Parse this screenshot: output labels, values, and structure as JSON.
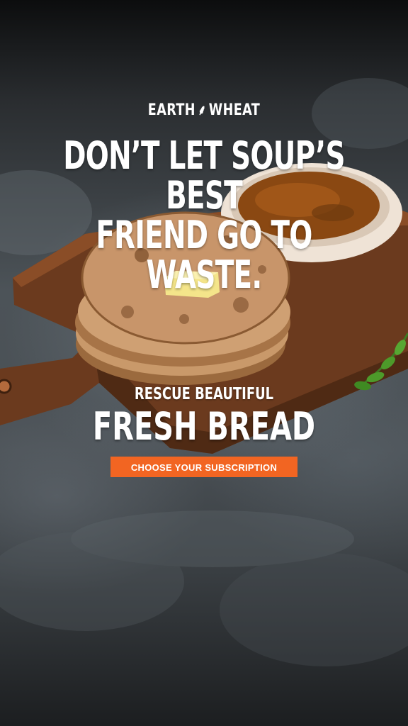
{
  "brand": {
    "left": "EARTH",
    "right": "WHEAT",
    "icon": "wheat-icon"
  },
  "headline": {
    "line1": "DON’T LET SOUP’S BEST",
    "line2": "FRIEND GO TO WASTE."
  },
  "subheadline": {
    "line1": "RESCUE BEAUTIFUL",
    "line2": "FRESH BREAD"
  },
  "cta": {
    "label": "CHOOSE YOUR SUBSCRIPTION"
  },
  "colors": {
    "accent": "#f26522",
    "text": "#ffffff",
    "board": "#6b3a1e"
  }
}
